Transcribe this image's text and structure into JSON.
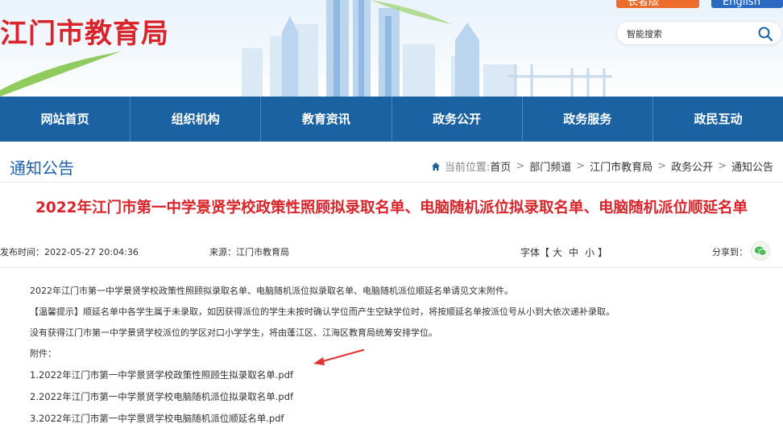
{
  "header": {
    "site_title": "江门市教育局",
    "elder_button": "长者版",
    "english_button": "English",
    "search_placeholder": "智能搜索"
  },
  "nav": {
    "items": [
      "网站首页",
      "组织机构",
      "教育资讯",
      "政务公开",
      "政务服务",
      "政民互动"
    ]
  },
  "section": {
    "title": "通知公告",
    "breadcrumb_label": "当前位置:",
    "breadcrumb": [
      "首页",
      "部门频道",
      "江门市教育局",
      "政务公开",
      "通知公告"
    ]
  },
  "article": {
    "title": "2022年江门市第一中学景贤学校政策性照顾拟录取名单、电脑随机派位拟录取名单、电脑随机派位顺延名单",
    "publish_date": "发布时间：2022-05-27 20:04:36",
    "source": "来源：江门市教育局",
    "font_label_open": "字体【",
    "font_large": "大",
    "font_medium": "中",
    "font_small": "小",
    "font_label_close": "】",
    "share_label": "分享到：",
    "paragraphs": [
      "2022年江门市第一中学景贤学校政策性照顾拟录取名单、电脑随机派位拟录取名单、电脑随机派位顺延名单请见文末附件。",
      "【温馨提示】顺延名单中各学生属于未录取，如因获得派位的学生未按时确认学位而产生空缺学位时，将按顺延名单按派位号从小到大依次递补录取。",
      "没有获得江门市第一中学景贤学校派位的学区对口小学学生，将由蓬江区、江海区教育局统筹安排学位。",
      "附件："
    ],
    "attachments": [
      "1.2022年江门市第一中学景贤学校政策性照顾生拟录取名单.pdf",
      "2.2022年江门市第一中学景贤学校电脑随机派位拟录取名单.pdf",
      "3.2022年江门市第一中学景贤学校电脑随机派位顺延名单.pdf"
    ]
  },
  "colors": {
    "brand_red": "#d8242a",
    "nav_blue": "#1b62a3",
    "elder_orange": "#ed6c2c",
    "english_blue": "#2b6ac3",
    "wechat_green": "#3bb44a"
  },
  "icons": {
    "search": "search-icon",
    "home": "home-icon",
    "wechat": "wechat-icon",
    "arrow": "red-arrow-annotation"
  }
}
